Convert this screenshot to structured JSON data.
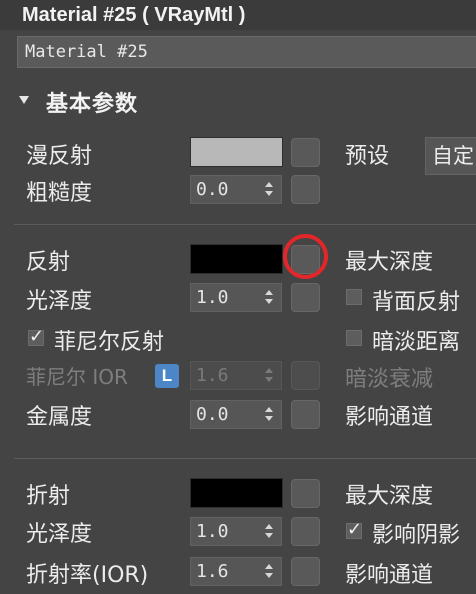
{
  "window": {
    "title": "Material #25 ( VRayMtl )"
  },
  "material_name": "Material #25",
  "rollout": {
    "title": "基本参数"
  },
  "diffuse": {
    "label": "漫反射",
    "color": "#b8b8b8",
    "roughness_label": "粗糙度",
    "roughness_value": "0.0",
    "preset_label": "预设",
    "preset_value": "自定"
  },
  "reflection": {
    "label": "反射",
    "color": "#000000",
    "glossiness_label": "光泽度",
    "glossiness_value": "1.0",
    "fresnel_label": "菲尼尔反射",
    "fresnel_checked": true,
    "fresnel_ior_label": "菲尼尔 IOR",
    "lock_label": "L",
    "fresnel_ior_value": "1.6",
    "metalness_label": "金属度",
    "metalness_value": "0.0",
    "max_depth_label": "最大深度",
    "back_side_label": "背面反射",
    "back_side_checked": false,
    "dim_distance_label": "暗淡距离",
    "dim_distance_checked": false,
    "dim_falloff_label": "暗淡衰减",
    "affect_channels_label": "影响通道"
  },
  "refraction": {
    "label": "折射",
    "color": "#000000",
    "glossiness_label": "光泽度",
    "glossiness_value": "1.0",
    "ior_label": "折射率(IOR)",
    "ior_value": "1.6",
    "max_depth_label": "最大深度",
    "affect_shadows_label": "影响阴影",
    "affect_shadows_checked": true,
    "affect_channels_label": "影响通道"
  },
  "colors": {
    "background": "#444444",
    "highlight_ring": "#e2262a",
    "lock_blue": "#4c86c6"
  }
}
